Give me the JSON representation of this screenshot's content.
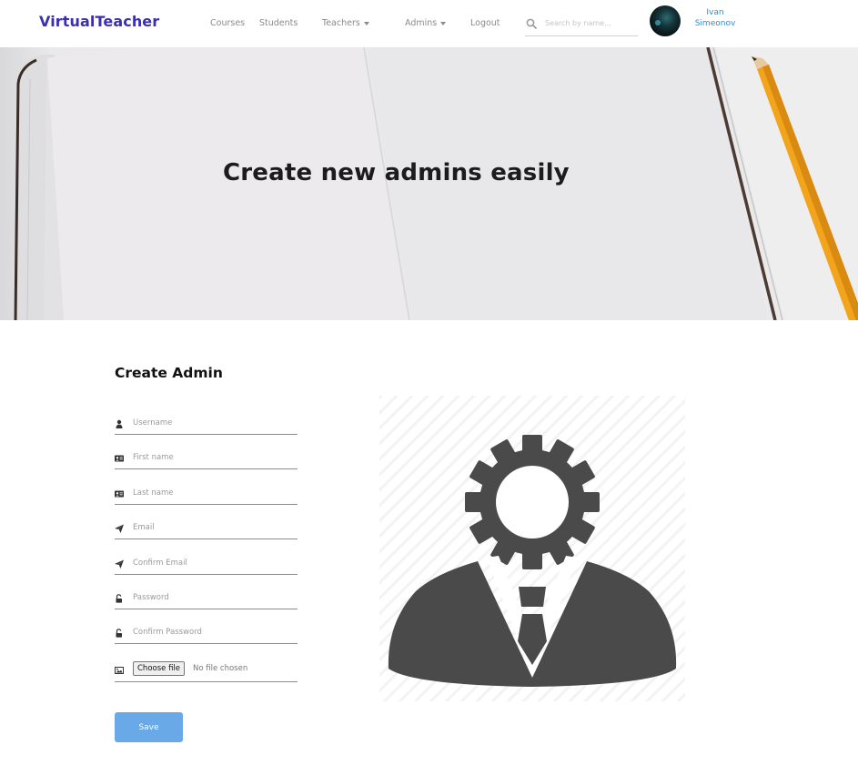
{
  "header": {
    "brand": "VirtualTeacher",
    "nav": {
      "courses": "Courses",
      "students": "Students",
      "teachers": "Teachers",
      "admins": "Admins",
      "logout": "Logout"
    },
    "search": {
      "placeholder": "Search by name...",
      "value": ""
    },
    "user": {
      "first_name": "Ivan",
      "last_name": "Simeonov"
    }
  },
  "hero": {
    "title": "Create new admins easily"
  },
  "form": {
    "title": "Create Admin",
    "fields": {
      "username": "Username",
      "first_name": "First name",
      "last_name": "Last name",
      "email": "Email",
      "confirm_email": "Confirm Email",
      "password": "Password",
      "confirm_password": "Confirm Password"
    },
    "file": {
      "button_label": "Choose file",
      "status": "No file chosen"
    },
    "save_label": "Save"
  },
  "colors": {
    "brand": "#3b2fb0",
    "user_link": "#2a8fd8",
    "save_button": "#6aa9e8",
    "icon_dark": "#4a4a4a"
  },
  "icons": [
    "search-icon",
    "user-icon",
    "id-card-icon",
    "paper-plane-icon",
    "unlock-icon",
    "image-icon",
    "admin-gear-person-icon"
  ]
}
